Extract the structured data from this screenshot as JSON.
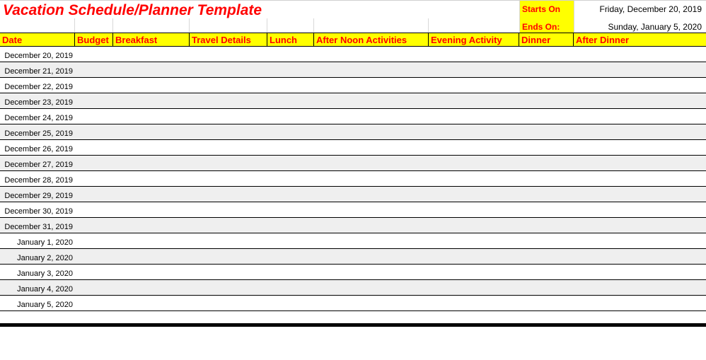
{
  "title": "Vacation Schedule/Planner Template",
  "info": {
    "starts_label": "Starts On",
    "starts_value": "Friday, December 20, 2019",
    "ends_label": "Ends On:",
    "ends_value": "Sunday, January 5, 2020"
  },
  "columns": {
    "date": "Date",
    "budget": "Budget",
    "breakfast": "Breakfast",
    "travel": "Travel Details",
    "lunch": "Lunch",
    "afternoon": "After Noon Activities",
    "evening": "Evening Activity",
    "dinner": "Dinner",
    "after_dinner": "After Dinner"
  },
  "rows": [
    {
      "date": "December 20, 2019"
    },
    {
      "date": "December 21, 2019"
    },
    {
      "date": "December 22, 2019"
    },
    {
      "date": "December 23, 2019"
    },
    {
      "date": "December 24, 2019"
    },
    {
      "date": "December 25, 2019"
    },
    {
      "date": "December 26, 2019"
    },
    {
      "date": "December 27, 2019"
    },
    {
      "date": "December 28, 2019"
    },
    {
      "date": "December 29, 2019"
    },
    {
      "date": "December 30, 2019"
    },
    {
      "date": "December 31, 2019"
    },
    {
      "date": "January 1, 2020"
    },
    {
      "date": "January 2, 2020"
    },
    {
      "date": "January 3, 2020"
    },
    {
      "date": "January 4, 2020"
    },
    {
      "date": "January 5, 2020"
    }
  ]
}
